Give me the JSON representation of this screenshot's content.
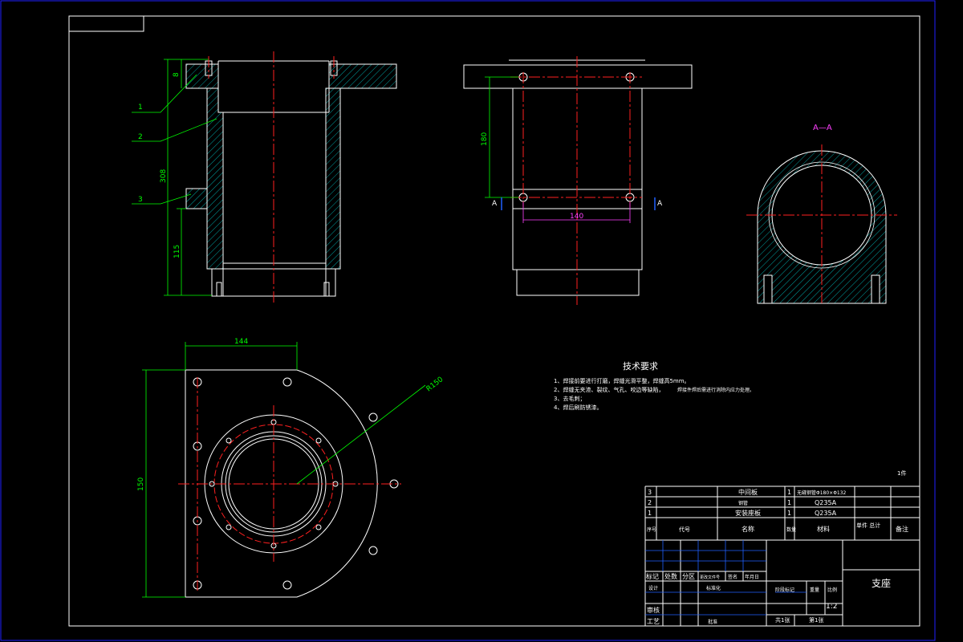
{
  "drawing": {
    "section_label": "A—A",
    "cut_mark": "A",
    "parts_count_note": "1件",
    "balloons": [
      "1",
      "2",
      "3"
    ]
  },
  "dimensions": {
    "front_top": "8",
    "front_total": "308",
    "front_lower": "115",
    "side_height": "180",
    "side_spacing": "140",
    "plan_width": "144",
    "plan_height": "150",
    "plan_radius": "R150"
  },
  "tech_requirements": {
    "title": "技术要求",
    "items": [
      "1、焊接前要进行打磨，焊缝光滑平整，焊缝高5mm。",
      "2、焊缝无夹渣、裂纹、气孔、咬边等缺陷，",
      "3、去毛刺；",
      "4、焊后刷防锈漆。"
    ],
    "item2_extra": "焊接件焊后需进行消除内应力处理。"
  },
  "bom": {
    "rows": [
      {
        "no": "3",
        "name": "中间板",
        "qty": "1",
        "material": "无缝钢管Φ180×Φ132"
      },
      {
        "no": "2",
        "name": "钢管",
        "qty": "1",
        "material": "Q235A"
      },
      {
        "no": "1",
        "name": "安装座板",
        "qty": "1",
        "material": "Q235A"
      }
    ],
    "header": {
      "no": "序号",
      "code": "代号",
      "name": "名称",
      "qty": "数量",
      "material": "材料",
      "weight": "单件 总计",
      "remark": "备注"
    }
  },
  "title_block": {
    "drawing_name": "支座",
    "scale_label": "比例",
    "scale": "1:2",
    "weight_label": "重量",
    "stage_label": "阶段标记",
    "sheets": "共1张",
    "sheet_no": "第1张",
    "labels": {
      "mark": "标记",
      "count": "处数",
      "zone": "分区",
      "change_doc": "更改文件号",
      "sign": "签名",
      "date": "年月日",
      "design": "设计",
      "standard": "标准化",
      "review": "审核",
      "process": "工艺",
      "approve": "批准"
    }
  }
}
